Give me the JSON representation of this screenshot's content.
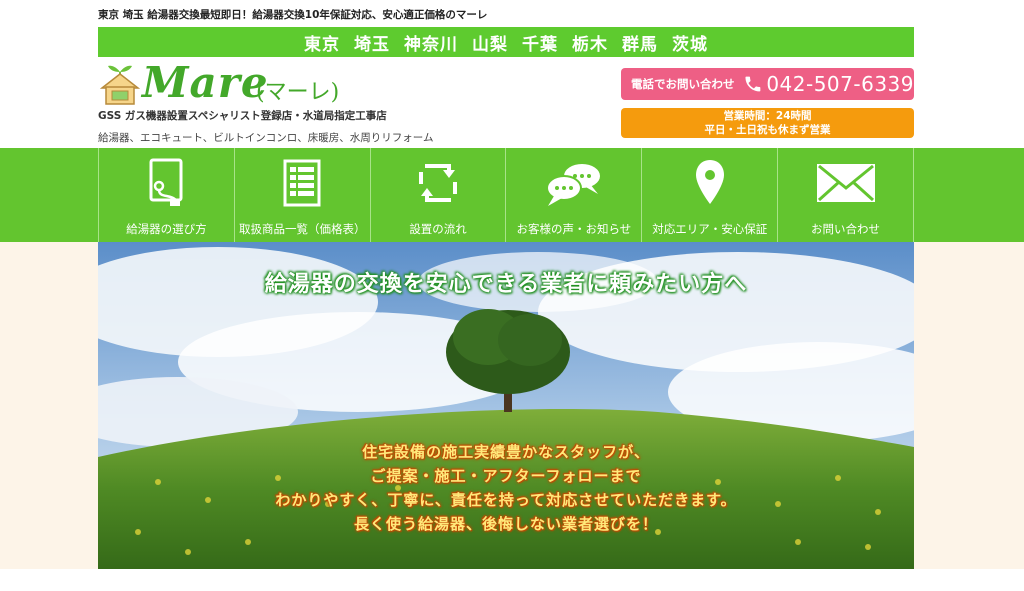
{
  "header": {
    "top_strip": "東京 埼玉 給湯器交換最短即日！給湯器交換10年保証対応、安心適正価格のマーレ",
    "areas": [
      "東京",
      "埼玉",
      "神奈川",
      "山梨",
      "千葉",
      "栃木",
      "群馬",
      "茨城"
    ],
    "brand": "Mare",
    "brand_kana": "(マーレ)",
    "tagline": "GSS ガス機器設置スペシャリスト登録店・水道局指定工事店",
    "services": "給湯器、エコキュート、ビルトインコンロ、床暖房、水周りリフォーム",
    "phone_label": "電話でお問い合わせ",
    "phone_number": "042-507-6339",
    "hours_line1": "営業時間：24時間",
    "hours_line2": "平日・土日祝も休まず営業"
  },
  "nav": {
    "items": [
      {
        "label": "給湯器の選び方",
        "icon": "water-heater-icon"
      },
      {
        "label": "取扱商品一覧（価格表）",
        "icon": "price-list-icon"
      },
      {
        "label": "設置の流れ",
        "icon": "cycle-arrows-icon"
      },
      {
        "label": "お客様の声・お知らせ",
        "icon": "speech-bubbles-icon"
      },
      {
        "label": "対応エリア・安心保証",
        "icon": "map-pin-icon"
      },
      {
        "label": "お問い合わせ",
        "icon": "envelope-icon"
      }
    ]
  },
  "hero": {
    "headline": "給湯器の交換を安心できる業者に頼みたい方へ",
    "body": [
      "住宅設備の施工実績豊かなスタッフが、",
      "ご提案・施工・アフターフォローまで",
      "わかりやすく、丁寧に、責任を持って対応させていただきます。",
      "長く使う給湯器、後悔しない業者選びを！"
    ]
  },
  "colors": {
    "brand_green": "#5ecb2f",
    "phone_pink": "#ee5f85",
    "hours_orange": "#f59b0d",
    "logo_green": "#43a82a"
  }
}
